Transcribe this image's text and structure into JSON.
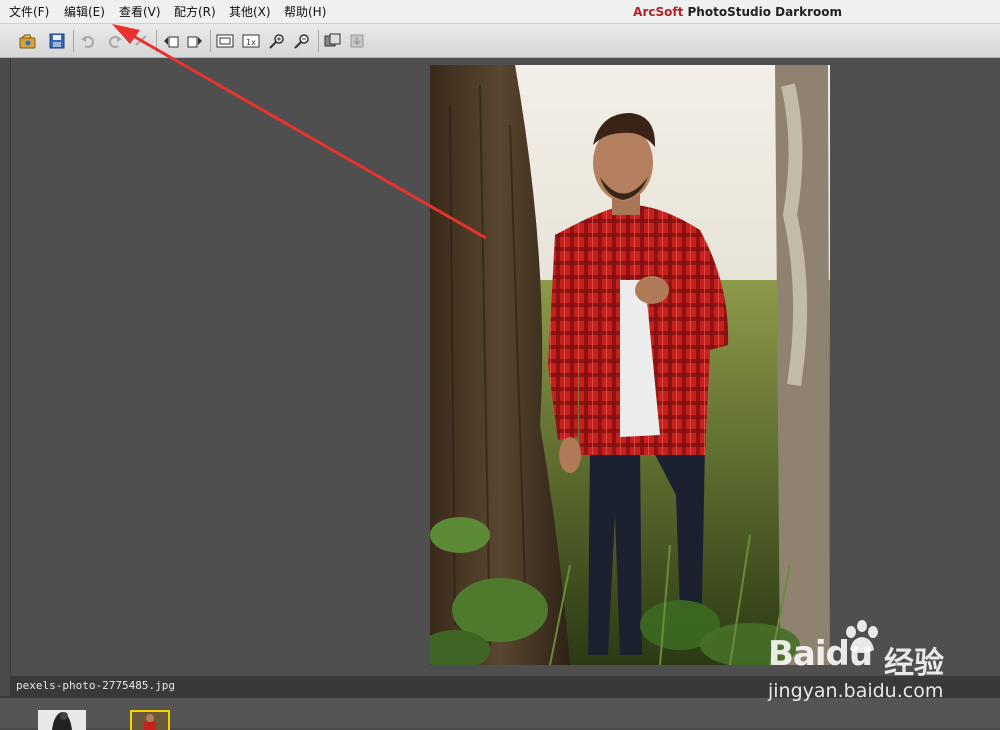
{
  "menu": {
    "items": [
      {
        "id": "file",
        "label": "文件(F)"
      },
      {
        "id": "edit",
        "label": "编辑(E)"
      },
      {
        "id": "view",
        "label": "查看(V)"
      },
      {
        "id": "recipe",
        "label": "配方(R)"
      },
      {
        "id": "other",
        "label": "其他(X)"
      },
      {
        "id": "help",
        "label": "帮助(H)"
      }
    ]
  },
  "app": {
    "brand": "ArcSoft",
    "title": "PhotoStudio Darkroom"
  },
  "toolbar": {
    "buttons": [
      "open-icon",
      "save-icon",
      "undo-icon",
      "redo-icon",
      "reset-icon",
      "rotate-left-icon",
      "rotate-right-icon",
      "fit-icon",
      "actual-size-icon",
      "zoom-in-icon",
      "zoom-out-icon",
      "compare-icon",
      "export-icon"
    ]
  },
  "status": {
    "filename": "pexels-photo-2775485.jpg"
  },
  "watermark": {
    "brand": "Baidu",
    "product": "经验",
    "url": "jingyan.baidu.com"
  },
  "colors": {
    "accent": "#e8322e",
    "title_brand": "#b0202a",
    "thumb_selected": "#f5d400"
  }
}
